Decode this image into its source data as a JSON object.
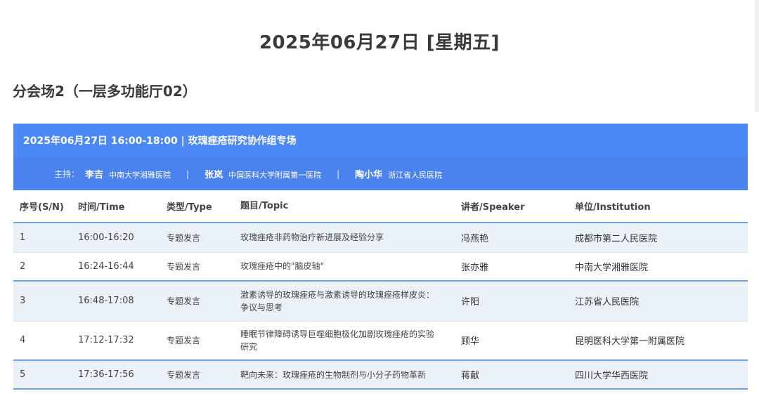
{
  "page": {
    "date_title": "2025年06月27日 [星期五]",
    "venue_title": "分会场2（一层多功能厅02）"
  },
  "session": {
    "header": "2025年06月27日 16:00-18:00 | 玫瑰痤疮研究协作组专场",
    "hosts_label": "主持：",
    "separator": "|",
    "hosts": [
      {
        "name": "李吉",
        "institution": "中南大学湘雅医院"
      },
      {
        "name": "张岚",
        "institution": "中国医科大学附属第一医院"
      },
      {
        "name": "陶小华",
        "institution": "浙江省人民医院"
      }
    ]
  },
  "table": {
    "columns": [
      "序号(S/N)",
      "时间/Time",
      "类型/Type",
      "题目/Topic",
      "讲者/Speaker",
      "单位/Institution"
    ],
    "rows": [
      {
        "sn": "1",
        "time": "16:00-16:20",
        "type": "专题发言",
        "topic_line1": "玫瑰痤疮非药物治疗新进展及经验分享",
        "topic_line2": "",
        "speaker": "冯燕艳",
        "institution": "成都市第二人民医院"
      },
      {
        "sn": "2",
        "time": "16:24-16:44",
        "type": "专题发言",
        "topic_line1": "玫瑰痤疮中的\"脑皮轴\"",
        "topic_line2": "",
        "speaker": "张亦雅",
        "institution": "中南大学湘雅医院"
      },
      {
        "sn": "3",
        "time": "16:48-17:08",
        "type": "专题发言",
        "topic_line1": "激素诱导的玫瑰痤疮与激素诱导的玫瑰痤疮样皮炎：",
        "topic_line2": "争议与思考",
        "speaker": "许阳",
        "institution": "江苏省人民医院"
      },
      {
        "sn": "4",
        "time": "17:12-17:32",
        "type": "专题发言",
        "topic_line1": "睡眠节律障碍诱导巨噬细胞极化加剧玫瑰痤疮的实验",
        "topic_line2": "研究",
        "speaker": "顾华",
        "institution": "昆明医科大学第一附属医院"
      },
      {
        "sn": "5",
        "time": "17:36-17:56",
        "type": "专题发言",
        "topic_line1": "靶向未来：玫瑰痤疮的生物制剂与小分子药物革新",
        "topic_line2": "",
        "speaker": "蒋献",
        "institution": "四川大学华西医院"
      }
    ]
  }
}
